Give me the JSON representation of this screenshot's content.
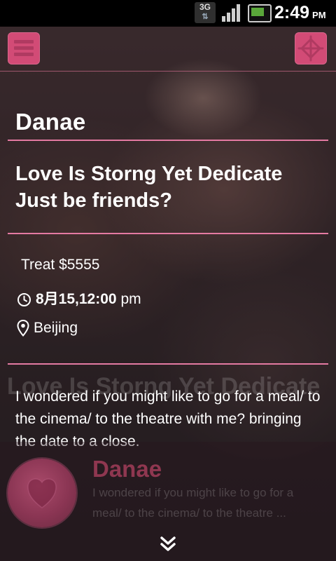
{
  "status_bar": {
    "network": "3G",
    "time": "2:49",
    "ampm": "PM"
  },
  "header": {
    "menu_icon": "list-menu-icon",
    "share_icon": "share-icon"
  },
  "profile": {
    "name": "Danae",
    "title_line1": "Love Is Storng Yet Dedicate",
    "title_line2": "Just be friends?"
  },
  "details": {
    "treat": "Treat $5555",
    "date_time": "8月15,12:00",
    "time_suffix": "pm",
    "location": "Beijing"
  },
  "message": {
    "text": "I wondered if you might like to go for a meal/ to the cinema/ to the theatre with me? bringing the date to a close."
  },
  "background_ghost": {
    "title": "Love Is Storng Yet Dedicate"
  },
  "card": {
    "name": "Danae",
    "message_line1": "I wondered if you might like to go for a",
    "message_line2": "meal/ to the  cinema/ to the theatre ...",
    "heart_icon": "heart-icon"
  },
  "colors": {
    "accent": "#d24b76",
    "divider": "#e47aa2"
  }
}
